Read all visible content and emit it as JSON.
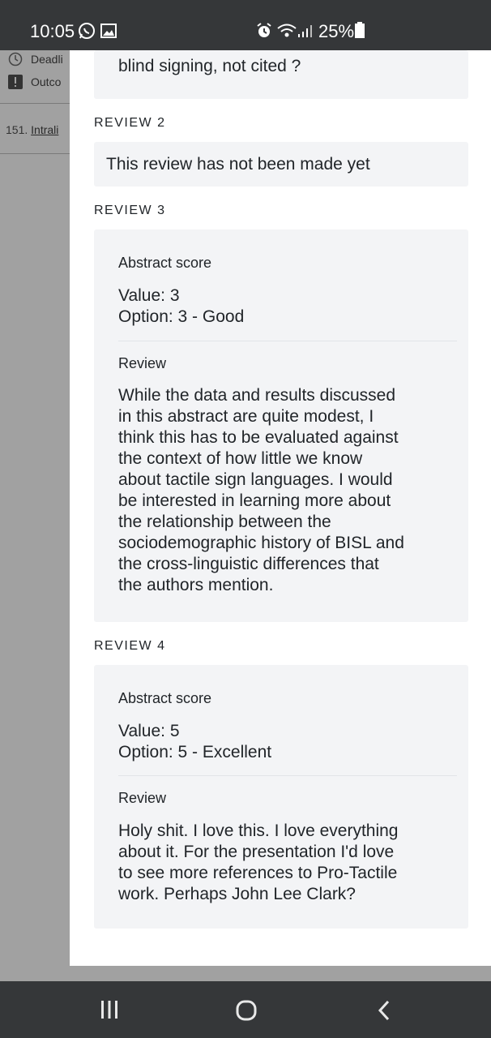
{
  "status_bar": {
    "time": "10:05",
    "battery": "25%",
    "icons": [
      "whatsapp-icon",
      "gallery-icon",
      "alarm-icon",
      "wifi-icon",
      "signal-icon",
      "battery-icon"
    ]
  },
  "background_page": {
    "row1_label": "Deadli",
    "row2_label": "Outco",
    "list_number": "151.",
    "list_link": "Intrali"
  },
  "modal": {
    "top_card_text": "blind signing, not cited ?",
    "review2": {
      "heading": "REVIEW 2",
      "message": "This review has not been made yet"
    },
    "review3": {
      "heading": "REVIEW 3",
      "score_label": "Abstract score",
      "value_line": "Value: 3",
      "option_line": "Option: 3 - Good",
      "review_label": "Review",
      "review_lines": [
        "While the data and results discussed",
        "in this abstract are quite modest, I",
        "think this has to be evaluated against",
        "the context of how little we know",
        "about tactile sign languages. I would",
        "be interested in learning more about",
        "the relationship between the",
        "sociodemographic history of BISL and",
        "the cross-linguistic differences that",
        "the authors mention."
      ]
    },
    "review4": {
      "heading": "REVIEW 4",
      "score_label": "Abstract score",
      "value_line": "Value: 5",
      "option_line": "Option: 5 - Excellent",
      "review_label": "Review",
      "review_lines": [
        "Holy shit. I love this. I love everything",
        "about it. For the presentation I'd love",
        "to see more references to Pro-Tactile",
        "work. Perhaps John Lee Clark?"
      ]
    }
  },
  "nav_bar": {
    "icons": [
      "recent-apps-icon",
      "home-icon",
      "back-icon"
    ]
  }
}
